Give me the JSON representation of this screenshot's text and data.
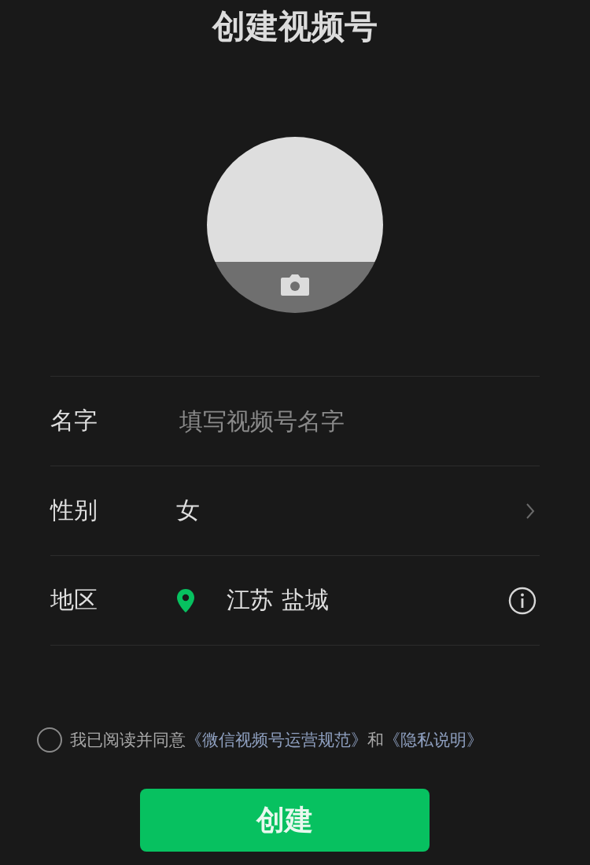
{
  "title": "创建视频号",
  "fields": [
    {
      "kind": "input",
      "label": "名字",
      "placeholder": "填写视频号名字"
    },
    {
      "kind": "select",
      "label": "性别",
      "value": "女"
    },
    {
      "kind": "location",
      "label": "地区",
      "value": "江苏 盐城"
    }
  ],
  "agreement": {
    "checked": false,
    "parts": [
      {
        "kind": "text",
        "text": "我已阅读并同意"
      },
      {
        "kind": "link",
        "text": "《微信视频号运营规范》"
      },
      {
        "kind": "text",
        "text": "和"
      },
      {
        "kind": "link",
        "text": "《隐私说明》"
      }
    ]
  },
  "button": "创建"
}
